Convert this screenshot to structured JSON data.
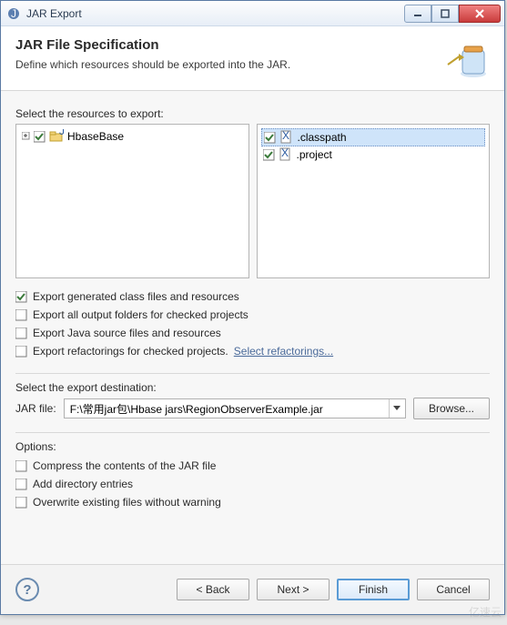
{
  "window": {
    "title": "JAR Export"
  },
  "header": {
    "title": "JAR File Specification",
    "subtitle": "Define which resources should be exported into the JAR."
  },
  "resources": {
    "label": "Select the resources to export:",
    "projects": [
      {
        "name": "HbaseBase",
        "checked": true
      }
    ],
    "files": [
      {
        "name": ".classpath",
        "checked": true,
        "selected": true
      },
      {
        "name": ".project",
        "checked": true,
        "selected": false
      }
    ]
  },
  "exportOptions": {
    "generatedClass": {
      "label": "Export generated class files and resources",
      "checked": true
    },
    "outputFolders": {
      "label": "Export all output folders for checked projects",
      "checked": false
    },
    "sourceFiles": {
      "label": "Export Java source files and resources",
      "checked": false
    },
    "refactorings": {
      "label": "Export refactorings for checked projects.",
      "checked": false,
      "link": "Select refactorings..."
    }
  },
  "destination": {
    "label": "Select the export destination:",
    "fieldLabel": "JAR file:",
    "path": "F:\\常用jar包\\Hbase jars\\RegionObserverExample.jar",
    "browse": "Browse..."
  },
  "options": {
    "label": "Options:",
    "compress": {
      "label": "Compress the contents of the JAR file",
      "checked": false
    },
    "addDir": {
      "label": "Add directory entries",
      "checked": false
    },
    "overwrite": {
      "label": "Overwrite existing files without warning",
      "checked": false
    }
  },
  "footer": {
    "back": "< Back",
    "next": "Next >",
    "finish": "Finish",
    "cancel": "Cancel"
  },
  "watermark": "亿速云"
}
